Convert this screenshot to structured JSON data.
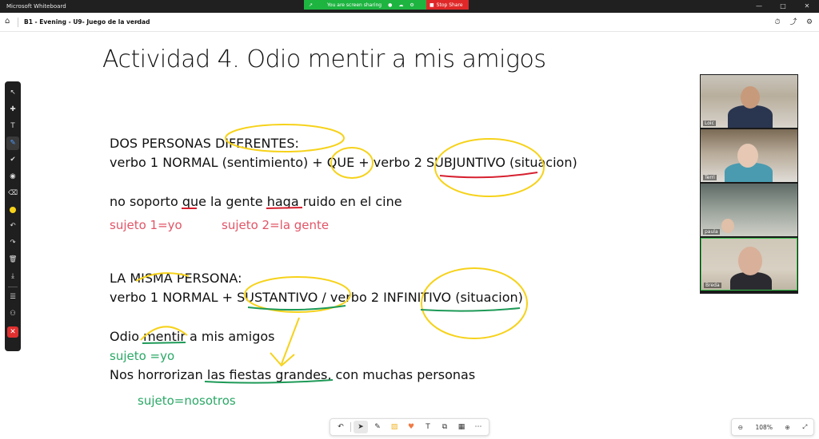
{
  "window": {
    "app_title": "Microsoft Whiteboard",
    "controls": {
      "minimize": "—",
      "maximize": "□",
      "close": "✕"
    }
  },
  "screen_share": {
    "status_text": "You are screen sharing",
    "stop_label": "Stop Share",
    "icons": {
      "share": "↗",
      "mic": "●",
      "cloud": "☁",
      "settings": "⚙"
    },
    "colors": {
      "bar": "#1db440",
      "stop": "#e02828"
    }
  },
  "toolbar": {
    "board_name": "B1 - Evening - U9- Juego de la verdad",
    "chevron": "⌄",
    "home": "⌂",
    "right_icons": [
      "⏱",
      "⤴",
      "⚙"
    ]
  },
  "whiteboard": {
    "title": "Actividad 4. Odio mentir a mis amigos",
    "section1_heading": "DOS PERSONAS DIFERENTES:",
    "section1_formula": "verbo 1 NORMAL (sentimiento) + QUE + verbo 2 SUBJUNTIVO (situacion)",
    "example1": "no soporto que la gente haga ruido en el cine",
    "subject1": "sujeto 1=yo",
    "subject2": "sujeto 2=la gente",
    "section2_heading": "LA MISMA PERSONA:",
    "section2_formula": "verbo 1 NORMAL +  SUSTANTIVO / verbo 2 INFINITIVO (situacion)",
    "example2": "Odio mentir a mis amigos",
    "subject3": "sujeto =yo",
    "example3": "Nos horrorizan las fiestas grandes, con muchas personas",
    "subject4": "sujeto=nosotros",
    "colors": {
      "highlight": "#f6d21a",
      "underline_red": "#d6202f",
      "underline_green": "#1d9a57",
      "note_red": "#e15567",
      "note_green": "#2aa866"
    }
  },
  "left_tools": {
    "icons": [
      "↖",
      "✚",
      "T",
      "✎",
      "✔",
      "◉",
      "⌫",
      "↶",
      "↷",
      "🗑",
      "⤓",
      "☰",
      "⚇",
      "✕"
    ],
    "active_color": "#f6d21a"
  },
  "participants": [
    {
      "name": "Loic"
    },
    {
      "name": "Terri"
    },
    {
      "name": "paula"
    },
    {
      "name": "Breda"
    }
  ],
  "bottom_tools": {
    "icons": [
      "↶",
      "➤",
      "✎",
      "▨",
      "♥",
      "T",
      "⧉",
      "▦",
      "⋯"
    ]
  },
  "zoom": {
    "zoom_out": "⊖",
    "level": "108%",
    "zoom_in": "⊕",
    "fit": "⤢"
  }
}
